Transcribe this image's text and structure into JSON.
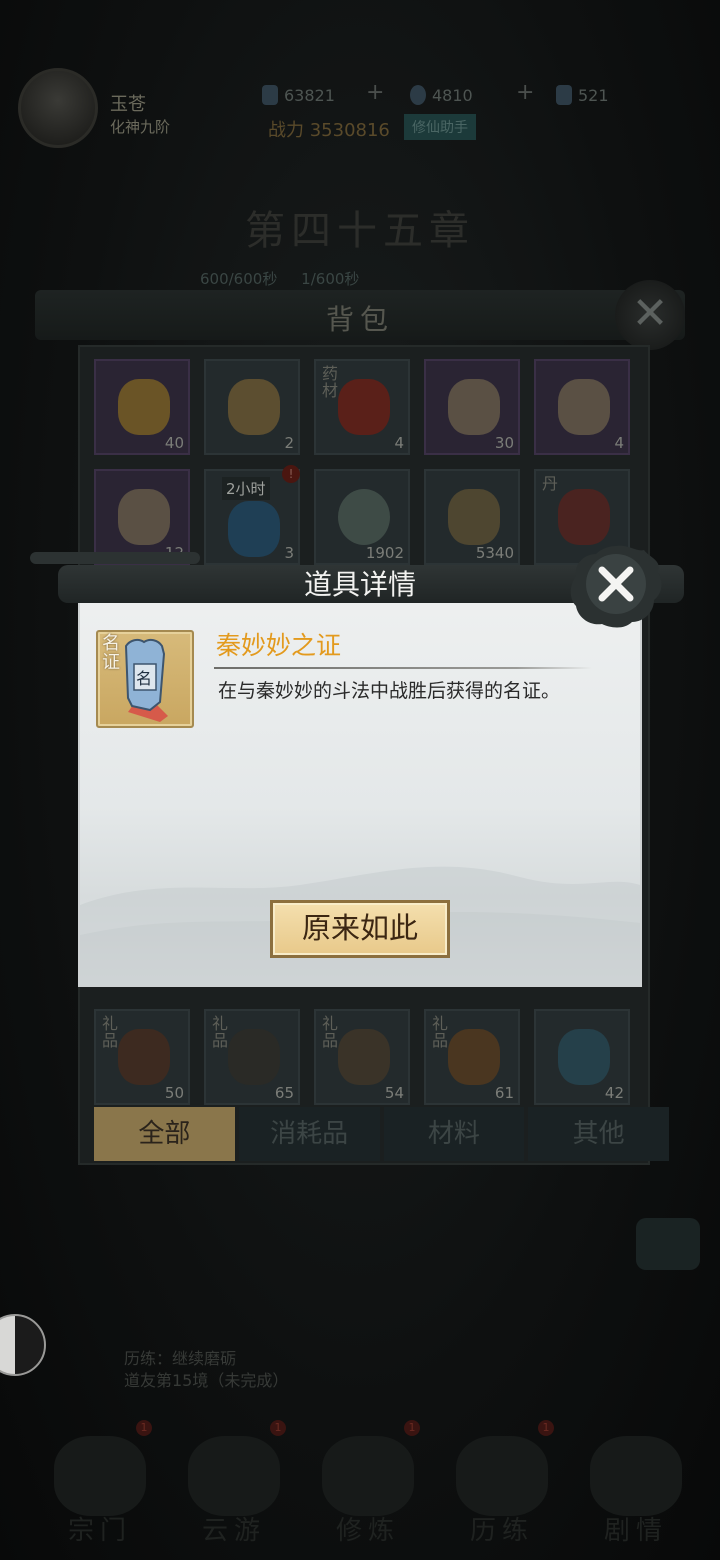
{
  "player": {
    "name": "玉苍",
    "rank": "化神九阶",
    "power_label": "战力 3530816",
    "power_badge": "修仙助手"
  },
  "resources": [
    {
      "icon": "spirit-stone-icon",
      "value": "63821"
    },
    {
      "icon": "coin-icon",
      "value": "4810"
    },
    {
      "icon": "scroll-icon",
      "value": "521"
    }
  ],
  "chapter": {
    "title": "第四十五章",
    "timer1": "600/600秒",
    "timer2": "1/600秒"
  },
  "bag": {
    "title": "背包",
    "close_icon": "close-icon",
    "items_row1": [
      {
        "icon": "gourd-icon",
        "count": "40",
        "tag": ""
      },
      {
        "icon": "vase-icon",
        "count": "2",
        "tag": ""
      },
      {
        "icon": "flame-icon",
        "count": "4",
        "tag": "药材"
      },
      {
        "icon": "puzzle-fragment-icon",
        "count": "30",
        "tag": ""
      },
      {
        "icon": "puzzle-fragment-icon",
        "count": "4",
        "tag": ""
      }
    ],
    "items_row2": [
      {
        "icon": "puzzle-fragment-icon",
        "count": "12",
        "tag": ""
      },
      {
        "icon": "water-orb-icon",
        "count": "3",
        "tag": "",
        "timer": "2小时",
        "badge": "!"
      },
      {
        "icon": "orb-icon",
        "count": "1902",
        "tag": ""
      },
      {
        "icon": "scroll-icon",
        "count": "5340",
        "tag": ""
      },
      {
        "icon": "pill-icon",
        "count": "",
        "tag": "丹"
      }
    ],
    "items_bottom": [
      {
        "icon": "braid-icon",
        "count": "50",
        "tag": "礼品"
      },
      {
        "icon": "brush-icon",
        "count": "65",
        "tag": "礼品"
      },
      {
        "icon": "bird-icon",
        "count": "54",
        "tag": "礼品"
      },
      {
        "icon": "gem-icon",
        "count": "61",
        "tag": "礼品"
      },
      {
        "icon": "spirit-flame-icon",
        "count": "42",
        "tag": ""
      }
    ],
    "tabs": [
      "全部",
      "消耗品",
      "材料",
      "其他"
    ],
    "active_tab": "全部"
  },
  "modal": {
    "title": "道具详情",
    "item_icon_tag": "名证",
    "item_name": "秦妙妙之证",
    "item_desc": "在与秦妙妙的斗法中战胜后获得的名证。",
    "confirm_label": "原来如此",
    "accent": "#e39a1d"
  },
  "task": {
    "line1": "历练：继续磨砺",
    "line2": "道友第15境（未完成）"
  },
  "nav": [
    {
      "label": "宗门",
      "badge": "1"
    },
    {
      "label": "云游",
      "badge": "1"
    },
    {
      "label": "修炼",
      "badge": "1"
    },
    {
      "label": "历练",
      "badge": "1"
    },
    {
      "label": "剧情",
      "badge": ""
    }
  ]
}
